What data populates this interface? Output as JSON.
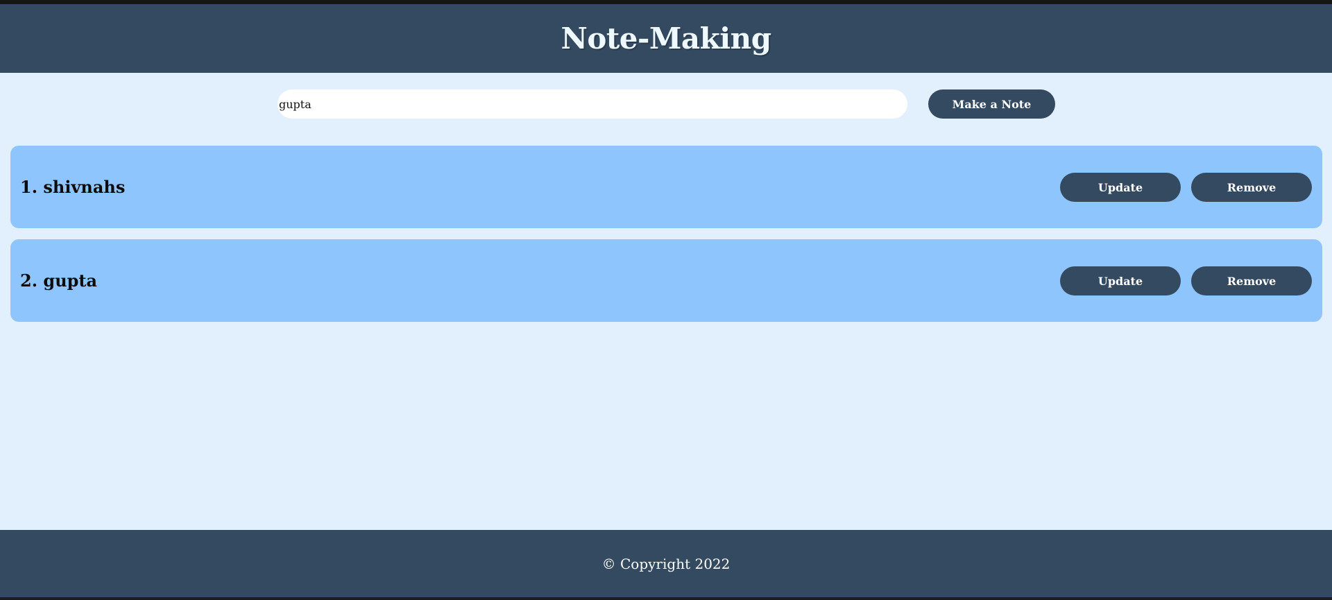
{
  "header": {
    "title": "Note-Making"
  },
  "composer": {
    "input_value": "gupta",
    "submit_label": "Make a Note"
  },
  "notes": [
    {
      "label": "1. shivnahs",
      "update_label": "Update",
      "remove_label": "Remove"
    },
    {
      "label": "2. gupta",
      "update_label": "Update",
      "remove_label": "Remove"
    }
  ],
  "footer": {
    "copyright": "© Copyright 2022"
  },
  "colors": {
    "header_bg": "#344a61",
    "page_bg": "#e2f0fd",
    "card_bg": "#8dc5fc",
    "button_bg": "#344a61"
  }
}
